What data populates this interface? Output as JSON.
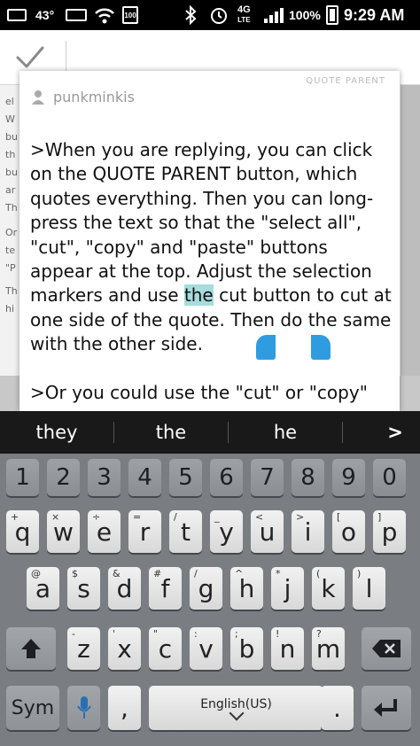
{
  "status_bar": {
    "temperature": "43°",
    "battery_label": "100",
    "network": "4G",
    "network_sub": "LTE",
    "battery_percent": "100%",
    "time": "9:29 AM"
  },
  "action_bar": {
    "confirm_icon": "check-icon"
  },
  "dialog": {
    "username": "punkminkis",
    "quote_label": "QUOTE PARENT",
    "text_before_selection": ">When you are replying, you can click on the QUOTE PARENT button, which quotes everything. Then you can long-press the text so that the \"select all\", \"cut\", \"copy\" and \"paste\" buttons appear at the top. Adjust the selection markers and use ",
    "selected_text": "the",
    "text_after_selection": " cut button to cut at one side of the quote. Then do the same with the other side.",
    "paragraph_2": ">Or you could use the \"cut\" or \"copy\""
  },
  "background_fragments": [
    "el",
    "W",
    "bu",
    "th",
    "bu",
    "ar",
    "Th",
    "Or",
    "te",
    "\"P",
    "Th",
    "hi"
  ],
  "suggestions": [
    "they",
    "the",
    "he"
  ],
  "suggestion_more": ">",
  "keyboard": {
    "numbers": [
      "1",
      "2",
      "3",
      "4",
      "5",
      "6",
      "7",
      "8",
      "9",
      "0"
    ],
    "row1": [
      {
        "main": "q",
        "sub": "+"
      },
      {
        "main": "w",
        "sub": "×"
      },
      {
        "main": "e",
        "sub": "÷"
      },
      {
        "main": "r",
        "sub": "="
      },
      {
        "main": "t",
        "sub": "/"
      },
      {
        "main": "y",
        "sub": "_"
      },
      {
        "main": "u",
        "sub": "<"
      },
      {
        "main": "i",
        "sub": ">"
      },
      {
        "main": "o",
        "sub": "["
      },
      {
        "main": "p",
        "sub": "]"
      }
    ],
    "row2": [
      {
        "main": "a",
        "sub": "@"
      },
      {
        "main": "s",
        "sub": "$"
      },
      {
        "main": "d",
        "sub": "&"
      },
      {
        "main": "f",
        "sub": "#"
      },
      {
        "main": "g",
        "sub": "/"
      },
      {
        "main": "h",
        "sub": "^"
      },
      {
        "main": "j",
        "sub": "*"
      },
      {
        "main": "k",
        "sub": "("
      },
      {
        "main": "l",
        "sub": ")"
      }
    ],
    "row3": [
      {
        "main": "z",
        "sub": "-"
      },
      {
        "main": "x",
        "sub": "'"
      },
      {
        "main": "c",
        "sub": "\""
      },
      {
        "main": "v",
        "sub": ":"
      },
      {
        "main": "b",
        "sub": ";"
      },
      {
        "main": "n",
        "sub": "!"
      },
      {
        "main": "m",
        "sub": "?"
      }
    ],
    "sym_label": "Sym",
    "comma_label": ",",
    "space_label": "English(US)",
    "period_label": ".",
    "shift_icon": "shift-arrow-icon",
    "mic_icon": "microphone-icon",
    "backspace_icon": "backspace-icon",
    "enter_icon": "enter-icon"
  }
}
